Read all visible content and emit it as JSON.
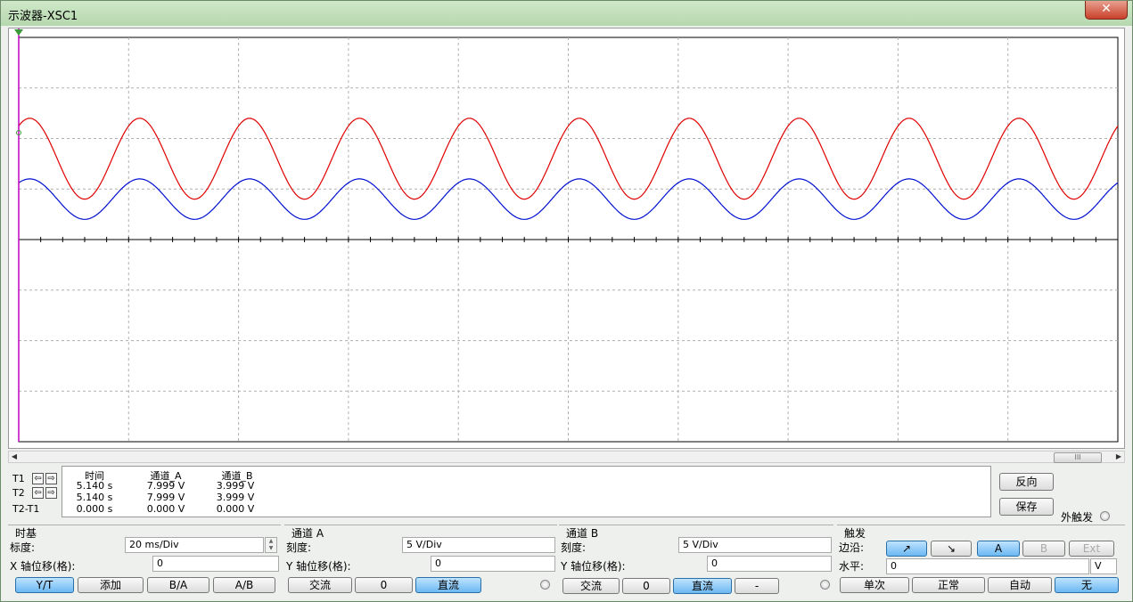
{
  "window": {
    "title": "示波器-XSC1",
    "close": "✕"
  },
  "scroll": {
    "thumb": "III"
  },
  "readout": {
    "t1": "T1",
    "t2": "T2",
    "t21": "T2-T1",
    "headers": [
      "时间",
      "通道_A",
      "通道_B"
    ],
    "rows": [
      [
        "5.140 s",
        "7.999 V",
        "3.999 V"
      ],
      [
        "5.140 s",
        "7.999 V",
        "3.999 V"
      ],
      [
        "0.000 s",
        "0.000 V",
        "0.000 V"
      ]
    ],
    "reverse_label": "反向",
    "save_label": "保存",
    "ext_trigger_label": "外触发"
  },
  "timebase": {
    "title": "时基",
    "scale_label": "标度:",
    "scale_value": "20 ms/Div",
    "xpos_label": "X 轴位移(格):",
    "xpos_value": "0",
    "buttons": [
      "Y/T",
      "添加",
      "B/A",
      "A/B"
    ]
  },
  "channel_a": {
    "title": "通道 A",
    "scale_label": "刻度:",
    "scale_value": "5  V/Div",
    "ypos_label": "Y 轴位移(格):",
    "ypos_value": "0",
    "buttons": [
      "交流",
      "0",
      "直流"
    ]
  },
  "channel_b": {
    "title": "通道 B",
    "scale_label": "刻度:",
    "scale_value": "5  V/Div",
    "ypos_label": "Y 轴位移(格):",
    "ypos_value": "0",
    "buttons": [
      "交流",
      "0",
      "直流",
      "-"
    ]
  },
  "trigger": {
    "title": "触发",
    "edge_label": "边沿:",
    "edge_buttons": [
      "↗",
      "↘",
      "A",
      "B",
      "Ext"
    ],
    "level_label": "水平:",
    "level_value": "0",
    "level_unit": "V",
    "mode_buttons": [
      "单次",
      "正常",
      "自动",
      "无"
    ]
  },
  "chart_data": {
    "type": "line",
    "x_range_div": [
      0,
      10
    ],
    "y_range_div": [
      -4,
      4
    ],
    "grid": true,
    "time_per_div_ms": 20,
    "volts_per_div": 5,
    "series": [
      {
        "color": "#e00000",
        "offset_v": 8.0,
        "amplitude_v": 4.0,
        "period_ms": 20
      },
      {
        "color": "#0010d0",
        "offset_v": 4.0,
        "amplitude_v": 2.0,
        "period_ms": 20
      }
    ],
    "colors": {
      "cursor": "#c000c0",
      "axis": "#000000",
      "grid": "#b0b0b0"
    }
  }
}
